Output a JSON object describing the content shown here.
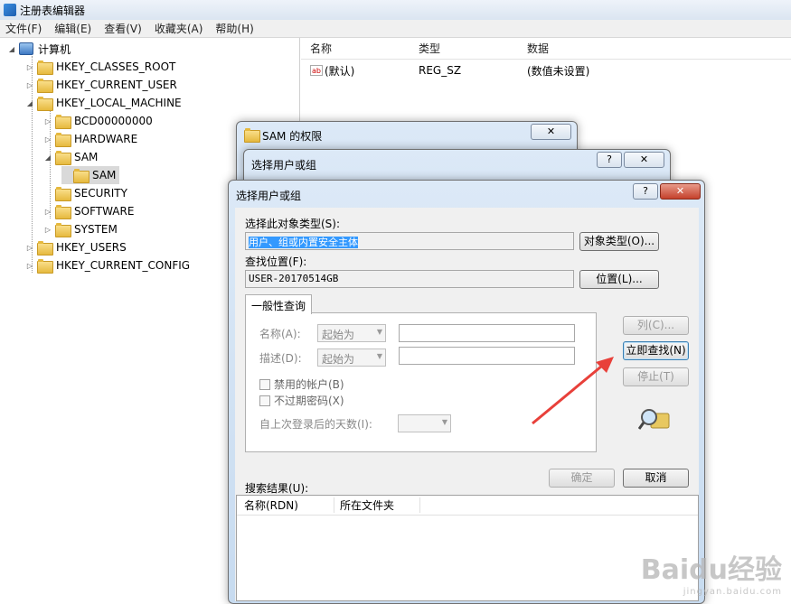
{
  "window": {
    "title": "注册表编辑器"
  },
  "menu": [
    "文件(F)",
    "编辑(E)",
    "查看(V)",
    "收藏夹(A)",
    "帮助(H)"
  ],
  "tree": {
    "root": "计算机",
    "hives": [
      "HKEY_CLASSES_ROOT",
      "HKEY_CURRENT_USER",
      "HKEY_LOCAL_MACHINE"
    ],
    "hklm_children": [
      "BCD00000000",
      "HARDWARE",
      "SAM"
    ],
    "sam_child": "SAM",
    "hklm_after": [
      "SECURITY",
      "SOFTWARE",
      "SYSTEM"
    ],
    "hives_after": [
      "HKEY_USERS",
      "HKEY_CURRENT_CONFIG"
    ]
  },
  "list": {
    "headers": [
      "名称",
      "类型",
      "数据"
    ],
    "rows": [
      {
        "name": "(默认)",
        "type": "REG_SZ",
        "data": "(数值未设置)"
      }
    ]
  },
  "perm_dialog": {
    "title": "SAM 的权限",
    "close": "✕"
  },
  "select_dialog_back": {
    "title": "选择用户或组",
    "help": "?",
    "close": "✕"
  },
  "select_dialog": {
    "title": "选择用户或组",
    "help": "?",
    "close": "✕",
    "object_type_label": "选择此对象类型(S):",
    "object_type_value": "用户、组或内置安全主体",
    "object_type_button": "对象类型(O)...",
    "location_label": "查找位置(F):",
    "location_value": "USER-20170514GB",
    "location_button": "位置(L)...",
    "tab": "一般性查询",
    "name_label": "名称(A):",
    "desc_label": "描述(D):",
    "starts_with": "起始为",
    "disabled_accounts": "禁用的帐户(B)",
    "no_expire": "不过期密码(X)",
    "days_label": "自上次登录后的天数(I):",
    "columns_button": "列(C)...",
    "find_now_button": "立即查找(N)",
    "stop_button": "停止(T)",
    "ok_button": "确定",
    "cancel_button": "取消",
    "results_label": "搜索结果(U):",
    "results_headers": [
      "名称(RDN)",
      "所在文件夹"
    ]
  },
  "watermark": {
    "brand": "Baidu经验",
    "url": "jingyan.baidu.com"
  },
  "colors": {
    "arrow": "#e8403a",
    "selection": "#3399ff"
  }
}
